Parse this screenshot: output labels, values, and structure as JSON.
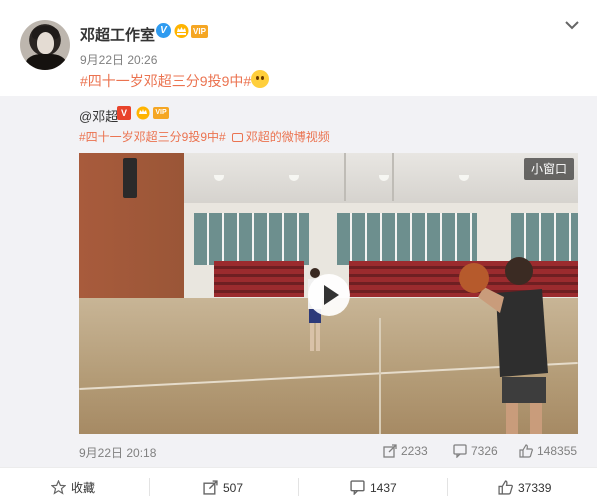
{
  "post": {
    "author": "邓超工作室",
    "vip_badge": "VIP",
    "time": "9月22日 20:26",
    "text": "#四十一岁邓超三分9投9中#"
  },
  "repost": {
    "author": "@邓超",
    "verified_badge": "V",
    "vip_badge": "VIP",
    "tags": "#四十一岁邓超三分9投9中#",
    "video_source": "邓超的微博视频",
    "small_window_label": "小窗口",
    "time": "9月22日 20:18",
    "reposts": "2233",
    "comments": "7326",
    "likes": "148355"
  },
  "actions": {
    "favorite": "收藏",
    "repost": "507",
    "comment": "1437",
    "like": "37339"
  },
  "colors": {
    "link": "#eb7350",
    "muted": "#808080",
    "repost_bg": "#f2f2f5",
    "verified_blue": "#2f9bf0",
    "verified_red": "#e8432b"
  }
}
